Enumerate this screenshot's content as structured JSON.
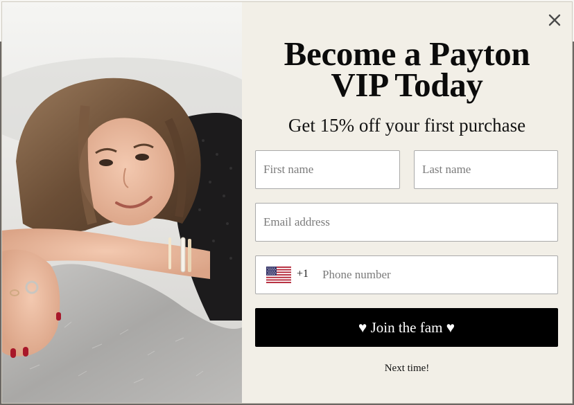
{
  "popup": {
    "headline_line1": "Become a Payton",
    "headline_line2": "VIP Today",
    "subheadline": "Get 15% off your first purchase",
    "first_name_placeholder": "First name",
    "last_name_placeholder": "Last name",
    "email_placeholder": "Email address",
    "phone_country_code": "+1",
    "phone_placeholder": "Phone number",
    "submit_label": "♥ Join the fam ♥",
    "dismiss_label": "Next time!",
    "close_icon": "close-icon",
    "flag_icon": "us-flag-icon"
  },
  "colors": {
    "panel_background": "#f2efe7",
    "button_background": "#000000",
    "button_text": "#ffffff"
  }
}
